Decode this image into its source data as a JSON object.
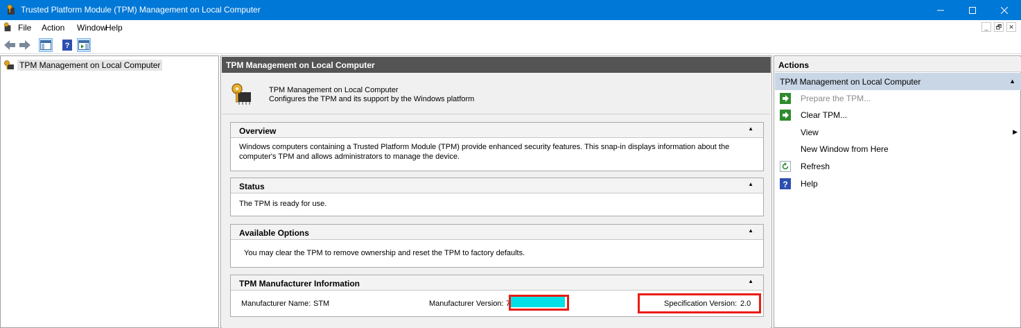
{
  "window": {
    "title": "Trusted Platform Module (TPM) Management on Local Computer",
    "controls": {
      "minimize": "─",
      "maximize": "☐",
      "close": "✕"
    }
  },
  "menubar": {
    "items": [
      "File",
      "Action",
      "Window",
      "Help"
    ],
    "mdi_controls": [
      "_",
      "🗗",
      "✕"
    ]
  },
  "tree": {
    "item_label": "TPM Management on Local Computer"
  },
  "center": {
    "header": "TPM Management on Local Computer",
    "banner_title": "TPM Management on Local Computer",
    "banner_subtitle": "Configures the TPM and its support by the Windows platform",
    "sections": {
      "overview": {
        "title": "Overview",
        "body": "Windows computers containing a Trusted Platform Module (TPM) provide enhanced security features. This snap-in displays information about the computer's TPM and allows administrators to manage the device."
      },
      "status": {
        "title": "Status",
        "body": "The TPM is ready for use."
      },
      "options": {
        "title": "Available Options",
        "body": "You may clear the TPM to remove ownership and reset the TPM to factory defaults."
      },
      "manufacturer": {
        "title": "TPM Manufacturer Information",
        "name_label": "Manufacturer Name:",
        "name_value": "STM",
        "version_label": "Manufacturer Version:",
        "version_value": "7",
        "spec_label": "Specification Version:",
        "spec_value": "2.0"
      }
    }
  },
  "actions": {
    "header": "Actions",
    "group": "TPM Management on Local Computer",
    "items": [
      {
        "label": "Prepare the TPM...",
        "enabled": false
      },
      {
        "label": "Clear TPM...",
        "enabled": true
      },
      {
        "label": "View",
        "enabled": true
      },
      {
        "label": "New Window from Here",
        "enabled": true
      },
      {
        "label": "Refresh",
        "enabled": true
      },
      {
        "label": "Help",
        "enabled": true
      }
    ]
  },
  "colors": {
    "titlebar": "#0078d7",
    "header_bar": "#545454",
    "action_group": "#c9d6e6",
    "highlight_box": "#ea1b13",
    "redaction": "#00e0e6"
  }
}
